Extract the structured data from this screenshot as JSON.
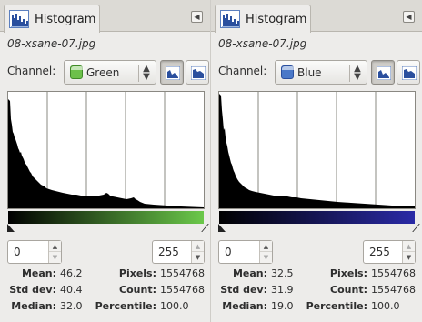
{
  "panels": [
    {
      "tab_label": "Histogram",
      "filename": "08-xsane-07.jpg",
      "channel_label": "Channel:",
      "channel_value": "Green",
      "channel_color": "#6cc04a",
      "gradient_end": "#6bc84a",
      "range_min": "0",
      "range_max": "255",
      "stats": {
        "mean_label": "Mean:",
        "mean": "46.2",
        "stddev_label": "Std dev:",
        "stddev": "40.4",
        "median_label": "Median:",
        "median": "32.0",
        "pixels_label": "Pixels:",
        "pixels": "1554768",
        "count_label": "Count:",
        "count": "1554768",
        "percentile_label": "Percentile:",
        "percentile": "100.0"
      }
    },
    {
      "tab_label": "Histogram",
      "filename": "08-xsane-07.jpg",
      "channel_label": "Channel:",
      "channel_value": "Blue",
      "channel_color": "#4a78c8",
      "gradient_end": "#2a2aa6",
      "range_min": "0",
      "range_max": "255",
      "stats": {
        "mean_label": "Mean:",
        "mean": "32.5",
        "stddev_label": "Std dev:",
        "stddev": "31.9",
        "median_label": "Median:",
        "median": "19.0",
        "pixels_label": "Pixels:",
        "pixels": "1554768",
        "count_label": "Count:",
        "count": "1554768",
        "percentile_label": "Percentile:",
        "percentile": "100.0"
      }
    }
  ],
  "icons": {
    "tab_icon": "histogram-icon",
    "menu_icon": "tab-menu-icon",
    "linear_mode": "linear-histogram-icon",
    "log_mode": "logarithmic-histogram-icon"
  }
}
